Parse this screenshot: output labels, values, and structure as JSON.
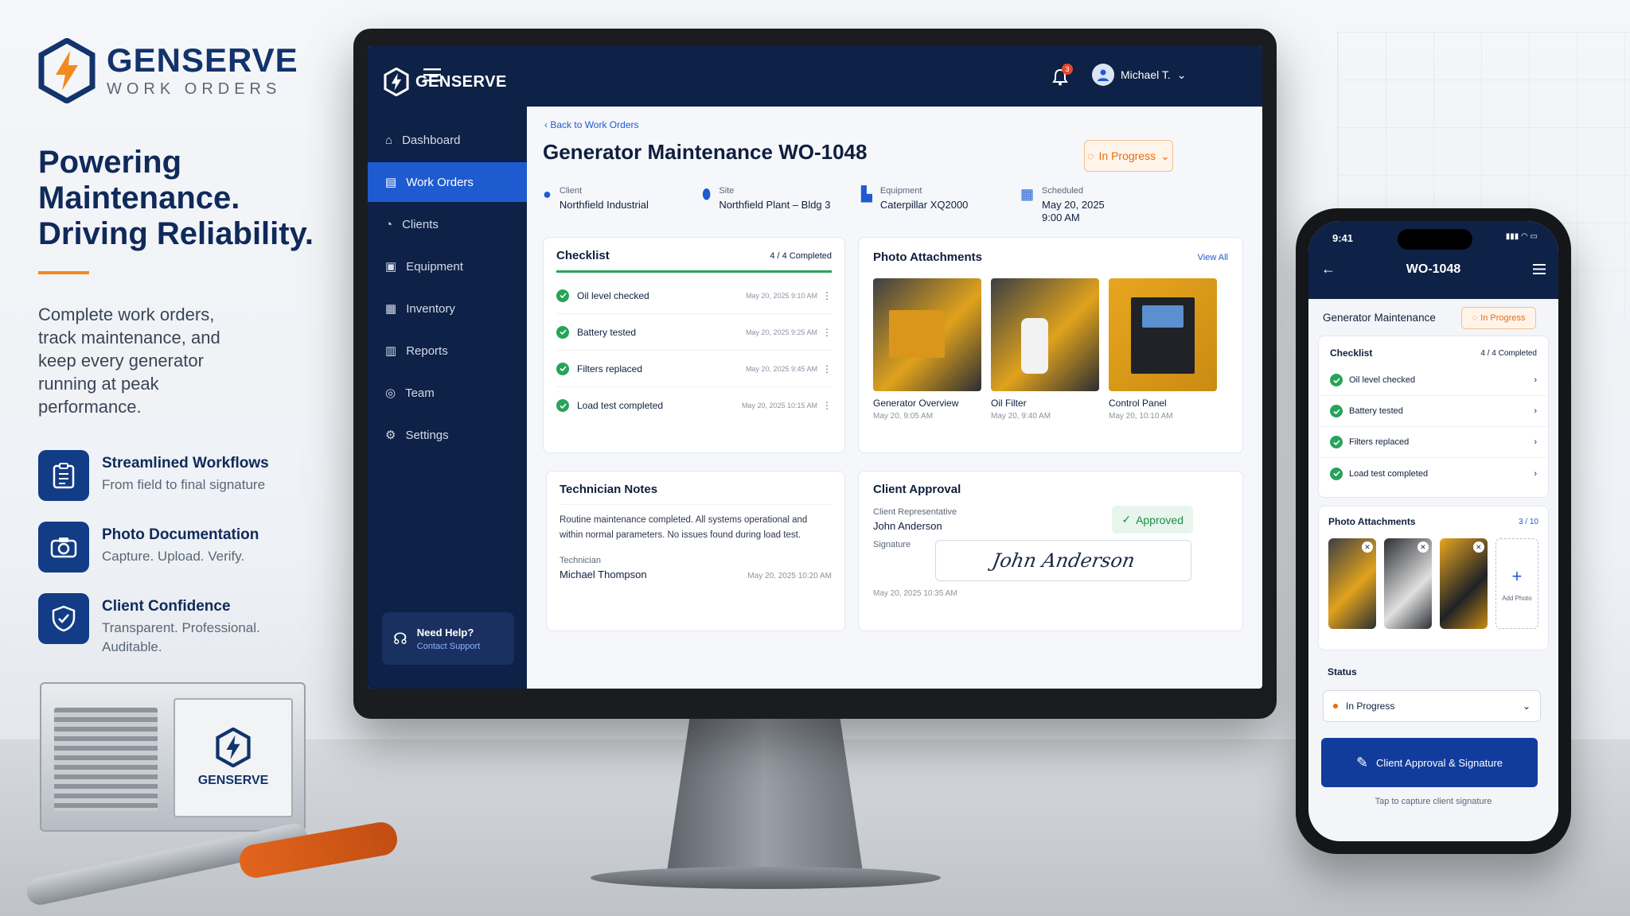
{
  "brand": {
    "name": "GENSERVE",
    "subtitle": "WORK ORDERS"
  },
  "hero": {
    "headline_1": "Powering",
    "headline_2": "Maintenance.",
    "headline_3": "Driving Reliability.",
    "intro": "Complete work orders, track maintenance, and keep every generator running at peak performance."
  },
  "features": [
    {
      "title": "Streamlined Workflows",
      "subtitle": "From field to final signature",
      "icon": "clipboard-icon"
    },
    {
      "title": "Photo Documentation",
      "subtitle": "Capture. Upload. Verify.",
      "icon": "camera-icon"
    },
    {
      "title": "Client Confidence",
      "subtitle": "Transparent. Professional. Auditable.",
      "icon": "shield-check-icon"
    }
  ],
  "generator_label": "GENSERVE",
  "app": {
    "brand": "GENSERVE",
    "nav": [
      {
        "label": "Dashboard",
        "icon": "home-icon"
      },
      {
        "label": "Work Orders",
        "icon": "clipboard-icon"
      },
      {
        "label": "Clients",
        "icon": "user-icon"
      },
      {
        "label": "Equipment",
        "icon": "equipment-icon"
      },
      {
        "label": "Inventory",
        "icon": "inventory-icon"
      },
      {
        "label": "Reports",
        "icon": "reports-icon"
      },
      {
        "label": "Team",
        "icon": "team-icon"
      },
      {
        "label": "Settings",
        "icon": "gear-icon"
      }
    ],
    "help": {
      "title": "Need Help?",
      "link": "Contact Support"
    },
    "notifications": "3",
    "user": "Michael T.",
    "back": "Back to Work Orders",
    "title": "Generator Maintenance WO-1048",
    "status": "In Progress",
    "meta": [
      {
        "label": "Client",
        "value": "Northfield Industrial"
      },
      {
        "label": "Site",
        "value": "Northfield Plant – Bldg 3"
      },
      {
        "label": "Equipment",
        "value": "Caterpillar XQ2000"
      },
      {
        "label": "Scheduled",
        "value": "May 20, 2025",
        "value2": "9:00 AM"
      }
    ],
    "checklist": {
      "title": "Checklist",
      "progress": "4 / 4 Completed",
      "items": [
        {
          "label": "Oil level checked",
          "date": "May 20, 2025 9:10 AM"
        },
        {
          "label": "Battery tested",
          "date": "May 20, 2025 9:25 AM"
        },
        {
          "label": "Filters replaced",
          "date": "May 20, 2025 9:45 AM"
        },
        {
          "label": "Load test completed",
          "date": "May 20, 2025 10:15 AM"
        }
      ]
    },
    "photos": {
      "title": "Photo Attachments",
      "view_all": "View All",
      "items": [
        {
          "label": "Generator Overview",
          "date": "May 20, 9:05 AM"
        },
        {
          "label": "Oil Filter",
          "date": "May 20, 9:40 AM"
        },
        {
          "label": "Control Panel",
          "date": "May 20, 10:10 AM"
        }
      ]
    },
    "notes": {
      "title": "Technician Notes",
      "body": "Routine maintenance completed. All systems operational and within normal parameters. No issues found during load test.",
      "tech_label": "Technician",
      "tech_name": "Michael Thompson",
      "date": "May 20, 2025 10:20 AM"
    },
    "approval": {
      "title": "Client Approval",
      "rep_label": "Client Representative",
      "rep_name": "John Anderson",
      "status": "Approved",
      "sig_label": "Signature",
      "signature": "John Anderson",
      "date": "May 20, 2025 10:35 AM"
    }
  },
  "phone": {
    "time": "9:41",
    "title": "WO-1048",
    "wo_title": "Generator Maintenance",
    "status": "In Progress",
    "checklist_title": "Checklist",
    "checklist_progress": "4 / 4 Completed",
    "items": [
      "Oil level checked",
      "Battery tested",
      "Filters replaced",
      "Load test completed"
    ],
    "photos_title": "Photo Attachments",
    "photos_count": "3 / 10",
    "add_photo": "Add Photo",
    "status_label": "Status",
    "status_value": "In Progress",
    "cta": "Client Approval & Signature",
    "hint": "Tap to capture client signature"
  },
  "colors": {
    "navy": "#0e2146",
    "blue": "#1f5bd0",
    "orange": "#e66d0f",
    "green": "#28a35a"
  }
}
